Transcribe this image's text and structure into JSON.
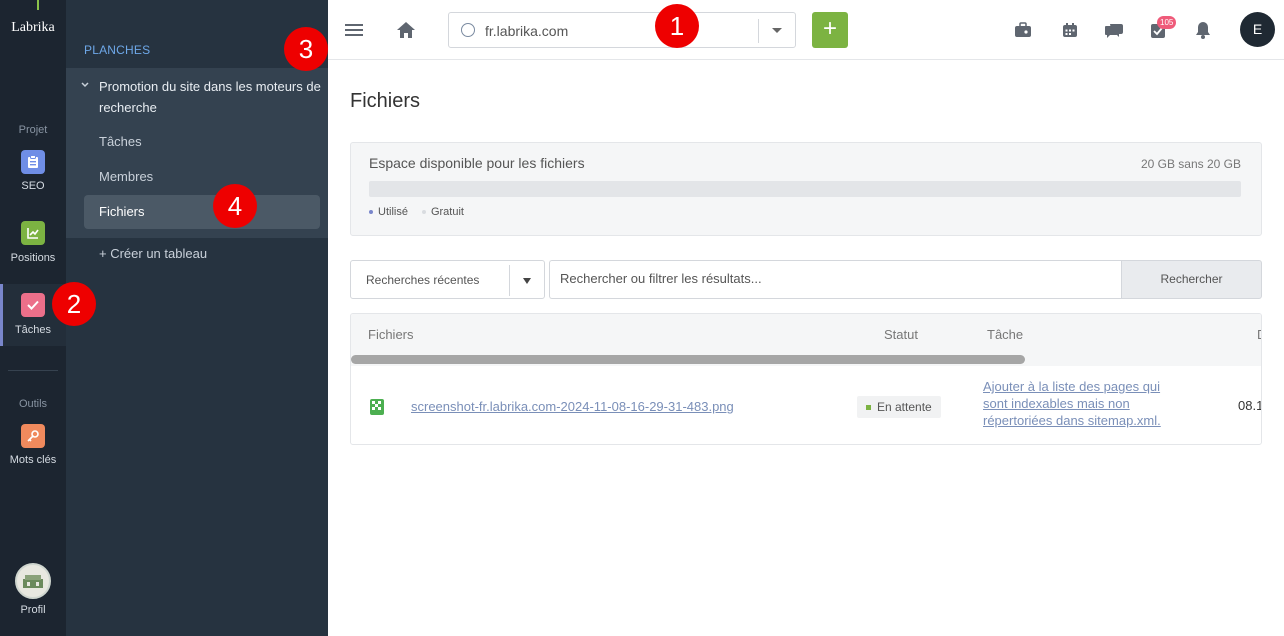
{
  "app": {
    "logo_text": "Labrika"
  },
  "rail": {
    "project_label": "Projet",
    "tools_label": "Outils",
    "items": [
      {
        "label": "SEO",
        "icon": "clipboard-icon",
        "color": "#6f8ee6"
      },
      {
        "label": "Positions",
        "icon": "chart-icon",
        "color": "#7cb342"
      },
      {
        "label": "Tâches",
        "icon": "check-icon",
        "color": "#ec6f8a",
        "active": true
      },
      {
        "label": "Mots clés",
        "icon": "key-icon",
        "color": "#f08a5d"
      }
    ],
    "profile_label": "Profil"
  },
  "sidebar": {
    "section_title": "PLANCHES",
    "board_title": "Promotion du site dans les moteurs de recherche",
    "sub_items": [
      {
        "label": "Tâches"
      },
      {
        "label": "Membres"
      },
      {
        "label": "Fichiers",
        "active": true
      }
    ],
    "create_label": "+ Créer un tableau"
  },
  "topbar": {
    "site_value": "fr.labrika.com",
    "add_label": "+",
    "notification_count": "105",
    "user_initial": "E"
  },
  "main": {
    "title": "Fichiers",
    "storage": {
      "label": "Espace disponible pour les fichiers",
      "amount": "20 GB sans 20 GB",
      "used_fraction": 0,
      "legend_used": "Utilisé",
      "legend_free": "Gratuit",
      "used_color": "#7986cb",
      "free_color": "#e3e5e8"
    },
    "search": {
      "recent_label": "Recherches récentes",
      "placeholder": "Rechercher ou filtrer les résultats...",
      "button_label": "Rechercher"
    },
    "table": {
      "columns": [
        "Fichiers",
        "Statut",
        "Tâche",
        "D"
      ],
      "rows": [
        {
          "file": "screenshot-fr.labrika.com-2024-11-08-16-29-31-483.png",
          "status": "En attente",
          "task": "Ajouter à la liste des pages qui sont indexables mais non répertoriées dans sitemap.xml.",
          "date": "08.1"
        }
      ]
    }
  },
  "markers": [
    "1",
    "2",
    "3",
    "4"
  ]
}
